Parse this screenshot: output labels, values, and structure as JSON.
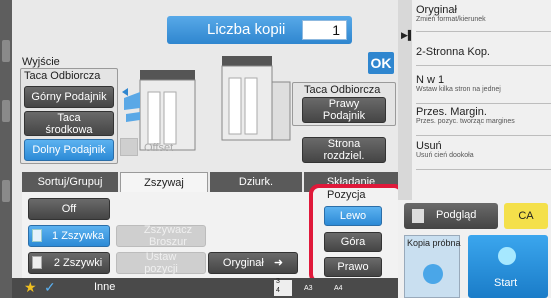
{
  "copies": {
    "label": "Liczba kopii",
    "value": "1"
  },
  "ok": "OK",
  "output": {
    "title": "Wyjście",
    "tray_title": "Taca Odbiorcza",
    "upper_tray": "Górny Podajnik",
    "center_tray": "Taca środkowa",
    "lower_tray": "Dolny Podajnik",
    "offset": "Offset",
    "right_tray_title": "Taca Odbiorcza",
    "right_tray": "Prawy Podajnik",
    "page_separator": "Strona rozdziel."
  },
  "tabs": [
    "Sortuj/Grupuj",
    "Zszywaj",
    "Dziurk.",
    "Składanie"
  ],
  "staple": {
    "off": "Off",
    "one": "1 Zszywka",
    "two": "2 Zszywki",
    "saddle": "Zszywacz Broszur",
    "set_position": "Ustaw pozycji",
    "original": "Oryginał"
  },
  "position": {
    "title": "Pozycja",
    "left": "Lewo",
    "top": "Góra",
    "right": "Prawo"
  },
  "bottom": {
    "other": "Inne",
    "nums": [
      "3",
      "4"
    ],
    "sizes": [
      "A3",
      "A4"
    ]
  },
  "right_panel": {
    "items": [
      {
        "title": "Oryginał",
        "sub": "Zmień format/kierunek"
      },
      {
        "title": "2-Stronna Kop.",
        "sub": ""
      },
      {
        "title": "N w 1",
        "sub": "Wstaw kilka stron na jednej"
      },
      {
        "title": "Przes. Margin.",
        "sub": "Przes. pozyc. tworząc margines"
      },
      {
        "title": "Usuń",
        "sub": "Usuń cień dookoła"
      }
    ],
    "preview": "Podgląd",
    "ca": "CA",
    "proof": "Kopia próbna",
    "start": "Start"
  },
  "colors": {
    "accent": "#2f86cf",
    "highlight": "#e0193a",
    "ca": "#f4e04a"
  }
}
